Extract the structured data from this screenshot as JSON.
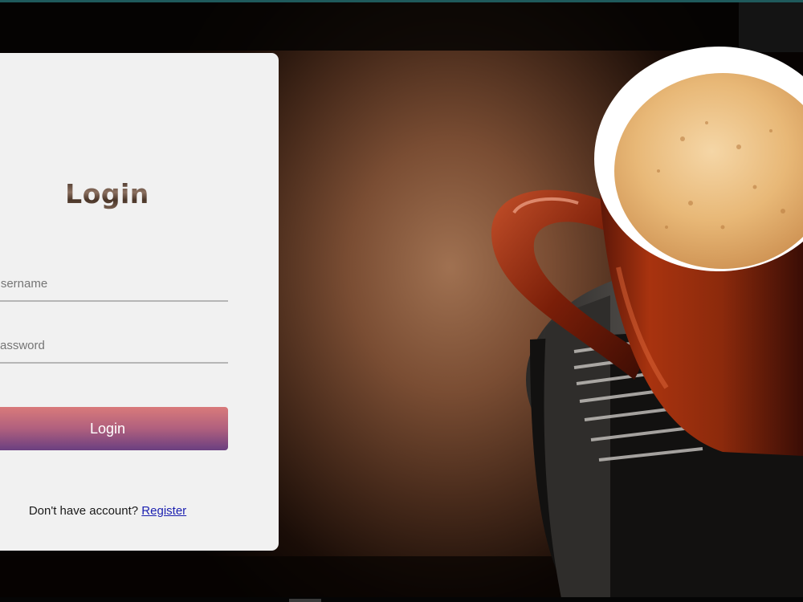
{
  "login_form": {
    "title": "Login",
    "username_placeholder": "Username",
    "password_placeholder": "Password",
    "submit_label": "Login",
    "register_prompt": "Don't have account?",
    "register_link_label": "Register"
  },
  "background": {
    "description_icon": "coffee-cup-photo",
    "accent_color": "#b0607e"
  }
}
